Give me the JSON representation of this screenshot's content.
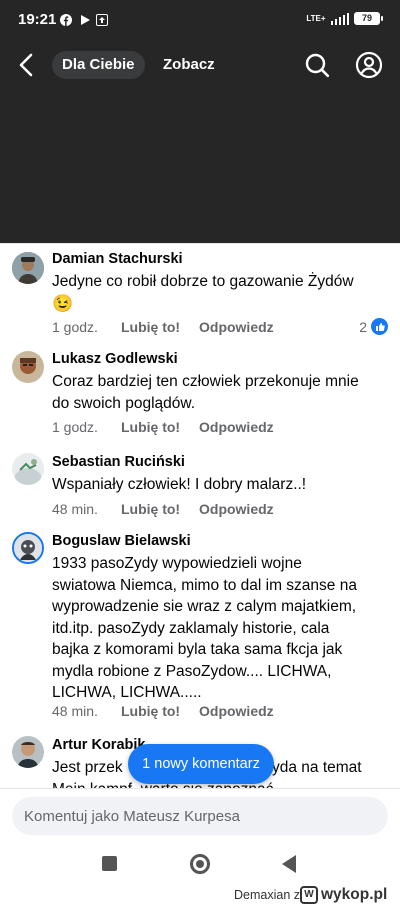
{
  "status": {
    "time": "19:21",
    "network": "LTE+",
    "battery": "79"
  },
  "nav": {
    "tab_active": "Dla Ciebie",
    "tab_second": "Zobacz"
  },
  "comments": [
    {
      "author": "Damian Stachurski",
      "text": "Jedyne co robił dobrze to gazowanie Żydów",
      "emoji": "😉",
      "time": "1 godz.",
      "like": "Lubię to!",
      "reply": "Odpowiedz",
      "reaction_count": "2"
    },
    {
      "author": "Lukasz Godlewski",
      "text_line1": "Coraz bardziej ten człowiek przekonuje mnie",
      "text_line2": "do swoich poglądów.",
      "time": "1 godz.",
      "like": "Lubię to!",
      "reply": "Odpowiedz"
    },
    {
      "author": "Sebastian Ruciński",
      "text": "Wspaniały człowiek! I dobry malarz..!",
      "time": "48 min.",
      "like": "Lubię to!",
      "reply": "Odpowiedz"
    },
    {
      "author": "Boguslaw Bielawski",
      "lines": [
        "1933 pasoZydy wypowiedzieli wojne",
        "swiatowa Niemca, mimo to dal im szanse na",
        "wyprowadzenie sie wraz z calym majatkiem,",
        "itd.itp. pasoZydy zaklamaly historie, cala",
        "bajka z komorami byla taka sama fkcja jak",
        "mydla robione z PasoZydow.... LICHWA,",
        "LICHWA, LICHWA....."
      ],
      "time": "48 min.",
      "like": "Lubię to!",
      "reply": "Odpowiedz"
    },
    {
      "author": "Artur Korabik",
      "line1_start": "Jest przek",
      "line1_end": "yda na temat",
      "line2": "Mein kampf, warto sie zapoznać."
    }
  ],
  "new_comments_label": "1 nowy komentarz",
  "compose": {
    "placeholder": "Komentuj jako Mateusz Kurpesa"
  },
  "watermark": {
    "user": "Demaxian",
    "separator": "z",
    "site": "wykop.pl"
  }
}
